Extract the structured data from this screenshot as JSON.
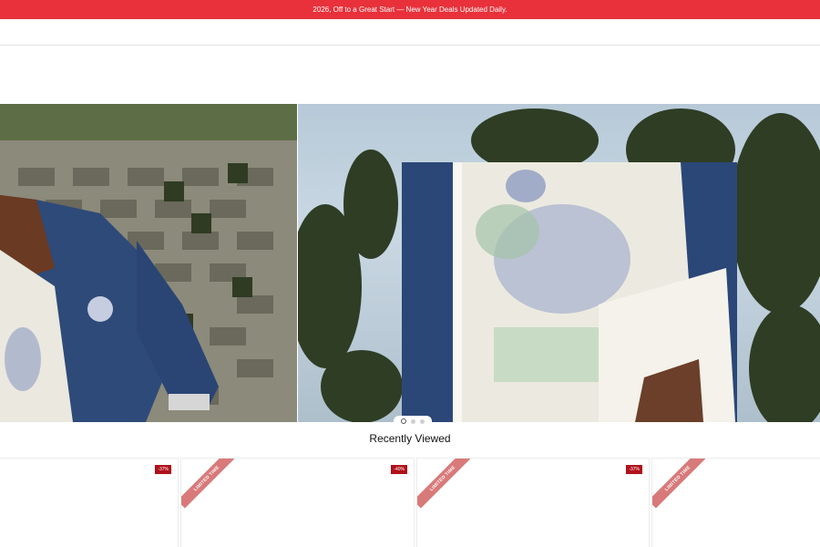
{
  "announcement": {
    "text": "2026, Off to a Great Start — New Year Deals Updated Daily."
  },
  "hero": {
    "slides": 3,
    "active_slide": 1
  },
  "recently_viewed": {
    "title": "Recently Viewed",
    "cards": [
      {
        "discount": "-37%",
        "ribbon": ""
      },
      {
        "discount": "-40%",
        "ribbon": "LIMITED TIME"
      },
      {
        "discount": "-37%",
        "ribbon": "LIMITED TIME"
      },
      {
        "discount": "",
        "ribbon": "LIMITED TIME"
      }
    ]
  },
  "colors": {
    "announcement_bg": "#e8313a",
    "discount_badge": "#b0121b",
    "ribbon": "#d97a7a"
  }
}
